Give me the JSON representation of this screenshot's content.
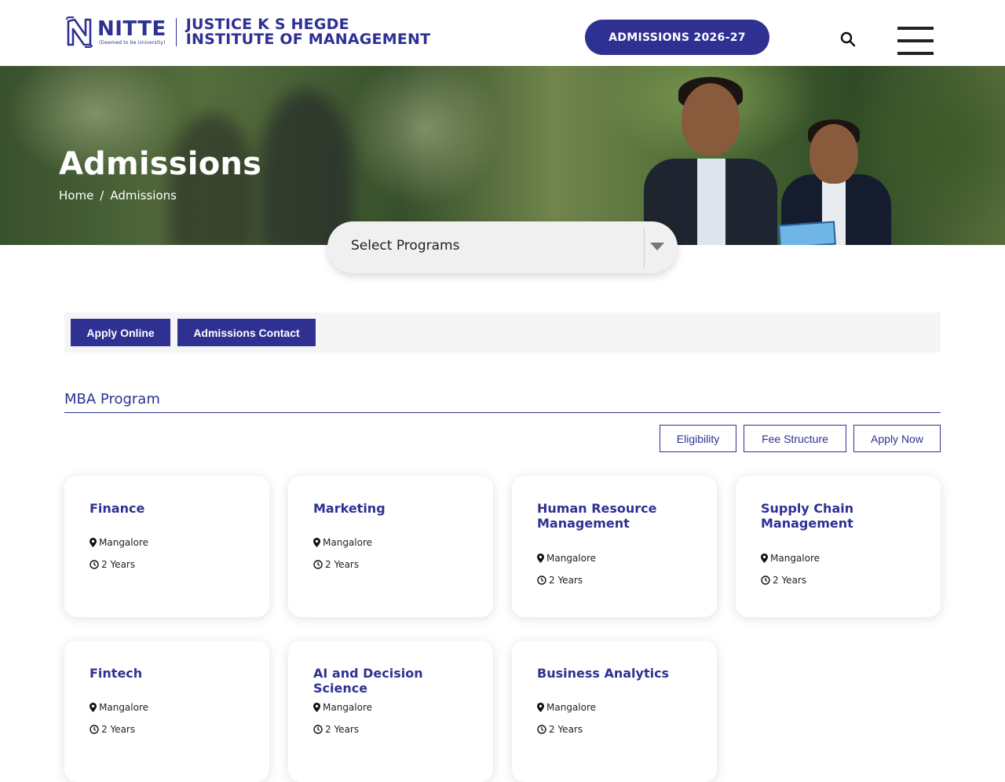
{
  "header": {
    "logo_brand": "NITTE",
    "logo_tagline": "(Deemed to be University)",
    "institute_line1": "JUSTICE K S HEGDE",
    "institute_line2": "INSTITUTE OF MANAGEMENT",
    "cta_label": "ADMISSIONS 2026-27",
    "search_icon": "search-icon",
    "menu_icon": "hamburger-menu-icon"
  },
  "hero": {
    "title": "Admissions",
    "breadcrumb": {
      "home": "Home",
      "separator": "/",
      "current": "Admissions"
    }
  },
  "program_select": {
    "selected": "Select Programs"
  },
  "tabs": {
    "apply_online": "Apply Online",
    "admissions_contact": "Admissions Contact"
  },
  "program": {
    "title": "MBA Program",
    "actions": {
      "eligibility": "Eligibility",
      "fee_structure": "Fee Structure",
      "apply_now": "Apply Now"
    },
    "cards": [
      {
        "title": "Finance",
        "location": "Mangalore",
        "duration": "2 Years"
      },
      {
        "title": "Marketing",
        "location": "Mangalore",
        "duration": "2 Years"
      },
      {
        "title": "Human Resource Management",
        "location": "Mangalore",
        "duration": "2 Years"
      },
      {
        "title": "Supply Chain Management",
        "location": "Mangalore",
        "duration": "2 Years"
      },
      {
        "title": "Fintech",
        "location": "Mangalore",
        "duration": "2 Years"
      },
      {
        "title": "AI and Decision Science",
        "location": "Mangalore",
        "duration": "2 Years"
      },
      {
        "title": "Business Analytics",
        "location": "Mangalore",
        "duration": "2 Years"
      }
    ]
  },
  "colors": {
    "brand": "#2e3192",
    "tab_bar_bg": "#f5f5f5",
    "select_bg": "#f0f0f0"
  }
}
